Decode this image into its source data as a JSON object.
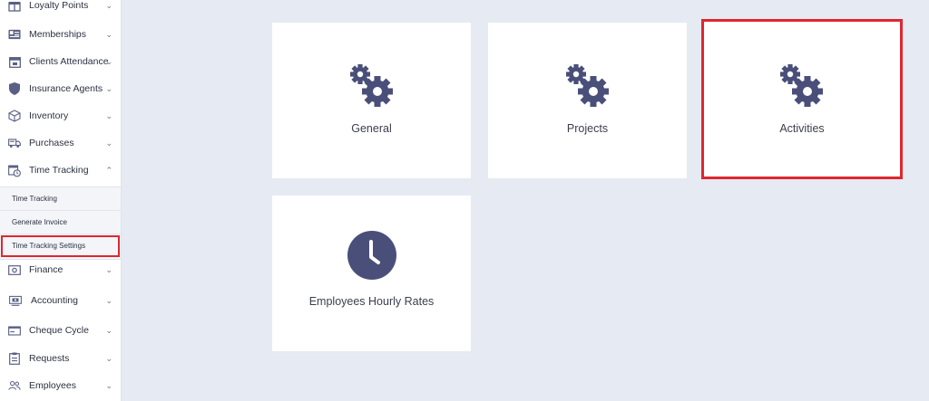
{
  "sidebar": {
    "items": [
      {
        "label": "Loyalty Points",
        "icon": "gift-icon",
        "chevron": "⌄"
      },
      {
        "label": "Memberships",
        "icon": "membership-card-icon",
        "chevron": "⌄"
      },
      {
        "label": "Clients Attendance",
        "icon": "calendar-icon",
        "chevron": "⌄"
      },
      {
        "label": "Insurance Agents",
        "icon": "shield-icon",
        "chevron": "⌄"
      },
      {
        "label": "Inventory",
        "icon": "box-icon",
        "chevron": "⌄"
      },
      {
        "label": "Purchases",
        "icon": "truck-icon",
        "chevron": "⌄"
      },
      {
        "label": "Time Tracking",
        "icon": "calendar-clock-icon",
        "chevron": "⌃"
      },
      {
        "label": "Finance",
        "icon": "money-icon",
        "chevron": "⌄"
      },
      {
        "label": "Accounting",
        "icon": "monitor-money-icon",
        "chevron": "⌄"
      },
      {
        "label": "Cheque Cycle",
        "icon": "cheque-icon",
        "chevron": "⌄"
      },
      {
        "label": "Requests",
        "icon": "clipboard-icon",
        "chevron": "⌄"
      },
      {
        "label": "Employees",
        "icon": "users-icon",
        "chevron": "⌄"
      }
    ],
    "time_tracking_sub": [
      {
        "label": "Time Tracking"
      },
      {
        "label": "Generate Invoice"
      },
      {
        "label": "Time Tracking Settings",
        "active": true
      }
    ]
  },
  "cards": [
    {
      "label": "General",
      "icon": "gears-icon"
    },
    {
      "label": "Projects",
      "icon": "gears-icon"
    },
    {
      "label": "Activities",
      "icon": "gears-icon",
      "highlighted": true
    },
    {
      "label": "Employees Hourly Rates",
      "icon": "clock-icon"
    }
  ],
  "colors": {
    "accent": "#4a4f7a",
    "highlight": "#e0262e",
    "background": "#e6eaf2"
  }
}
